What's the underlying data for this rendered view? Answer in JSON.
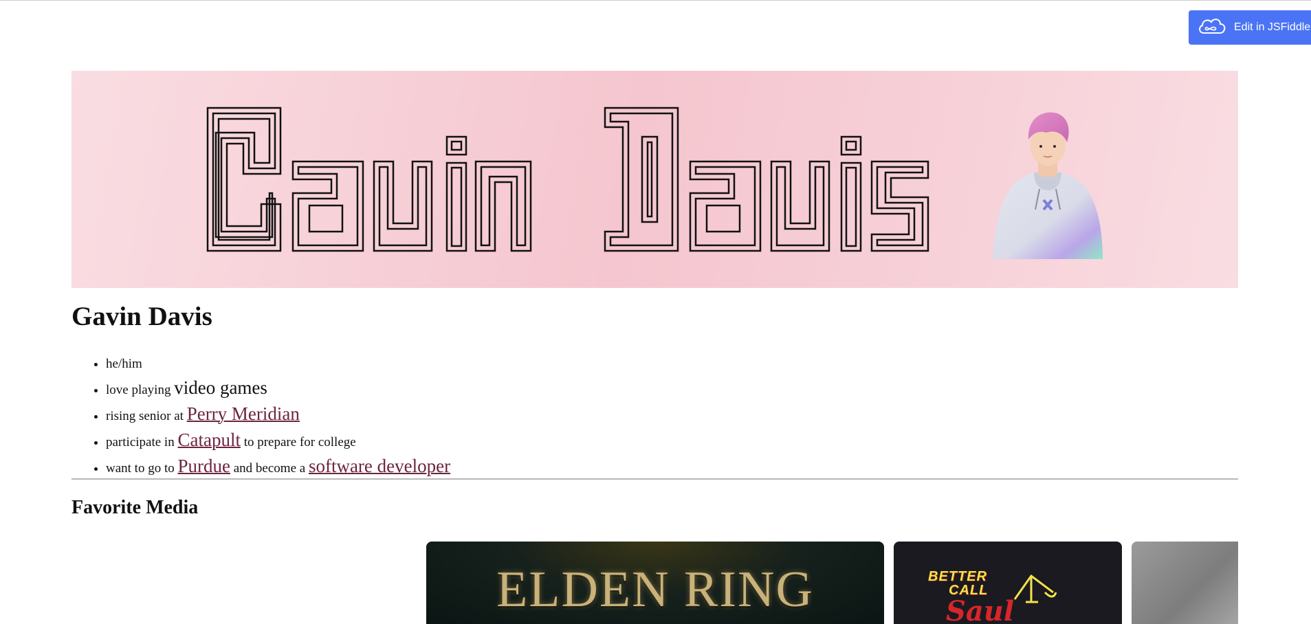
{
  "toolbar": {
    "edit_label": "Edit in JSFiddle",
    "edit_icon": "cloud-icon"
  },
  "banner": {
    "title": "Gavin Davis",
    "avatar_icon": "avatar-icon",
    "colors": {
      "background": "#f5c6cf",
      "outline": "#111111"
    }
  },
  "profile": {
    "name": "Gavin Davis",
    "facts": [
      {
        "text": "he/him"
      },
      {
        "before": "love playing ",
        "emphasis": "video games"
      },
      {
        "before": "rising senior at ",
        "link": "Perry Meridian"
      },
      {
        "before": "participate in ",
        "link": "Catapult",
        "after": " to prepare for college"
      },
      {
        "before": "want to go to ",
        "link": "Purdue",
        "middle": " and become a ",
        "link2": "software developer"
      }
    ]
  },
  "media": {
    "heading": "Favorite Media",
    "cards": [
      {
        "title": "ELDEN RING"
      },
      {
        "line1": "BETTER",
        "line2": "CALL",
        "line3": "Saul"
      },
      {
        "title": ""
      }
    ]
  },
  "colors": {
    "accent": "#4a74f5",
    "link": "#6d2440"
  }
}
